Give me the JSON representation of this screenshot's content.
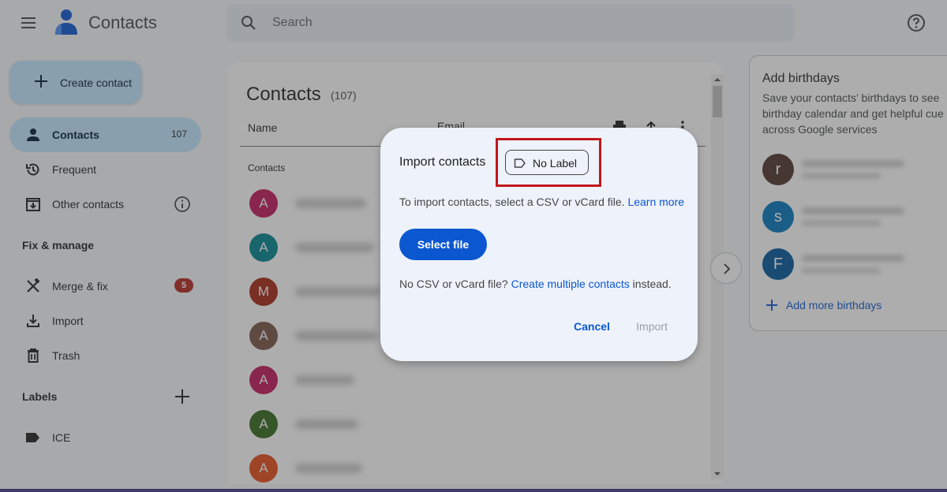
{
  "header": {
    "app_title": "Contacts",
    "search_placeholder": "Search",
    "menu_icon": "hamburger-menu-icon",
    "logo_icon": "contacts-person-logo",
    "help_icon": "help-circle-icon"
  },
  "sidebar": {
    "create_label": "Create contact",
    "items": [
      {
        "label": "Contacts",
        "count": "107",
        "icon": "person-icon",
        "active": true
      },
      {
        "label": "Frequent",
        "icon": "history-icon"
      },
      {
        "label": "Other contacts",
        "icon": "archive-download-icon",
        "info_icon": "info-icon"
      }
    ],
    "fix_manage_title": "Fix & manage",
    "fix_items": [
      {
        "label": "Merge & fix",
        "badge": "5",
        "icon": "tools-icon"
      },
      {
        "label": "Import",
        "icon": "download-icon"
      },
      {
        "label": "Trash",
        "icon": "trash-icon"
      }
    ],
    "labels_title": "Labels",
    "labels": [
      {
        "label": "ICE",
        "icon": "label-icon"
      }
    ]
  },
  "main": {
    "title": "Contacts",
    "count": "(107)",
    "columns": {
      "name": "Name",
      "email": "Email"
    },
    "group_label": "Contacts",
    "contacts": [
      {
        "initial": "A",
        "color": "#c2185b"
      },
      {
        "initial": "A",
        "color": "#00838f"
      },
      {
        "initial": "M",
        "color": "#a52714"
      },
      {
        "initial": "A",
        "color": "#795548"
      },
      {
        "initial": "A",
        "color": "#c2185b"
      },
      {
        "initial": "A",
        "color": "#33691e"
      },
      {
        "initial": "A",
        "color": "#e64a19"
      }
    ]
  },
  "birthdays": {
    "title": "Add birthdays",
    "description": "Save your contacts’ birthdays to see\nbirthday calendar and get helpful cue\nacross Google services",
    "contacts": [
      {
        "initial": "r",
        "color": "#4e342e"
      },
      {
        "initial": "s",
        "color": "#0277bd"
      },
      {
        "initial": "F",
        "color": "#01579b"
      }
    ],
    "add_more_label": "Add more birthdays"
  },
  "dialog": {
    "title": "Import contacts",
    "label_chip": "No Label",
    "text_before_link": "To import contacts, select a CSV or vCard file. ",
    "learn_more": "Learn more",
    "select_file": "Select file",
    "text2_before": "No CSV or vCard file? ",
    "create_multiple": "Create multiple contacts",
    "text2_after": " instead.",
    "cancel": "Cancel",
    "import": "Import"
  },
  "colors": {
    "accent": "#0b57d0",
    "active_nav": "#c2e7ff",
    "badge": "#b3261e",
    "highlight": "#c1161c"
  }
}
